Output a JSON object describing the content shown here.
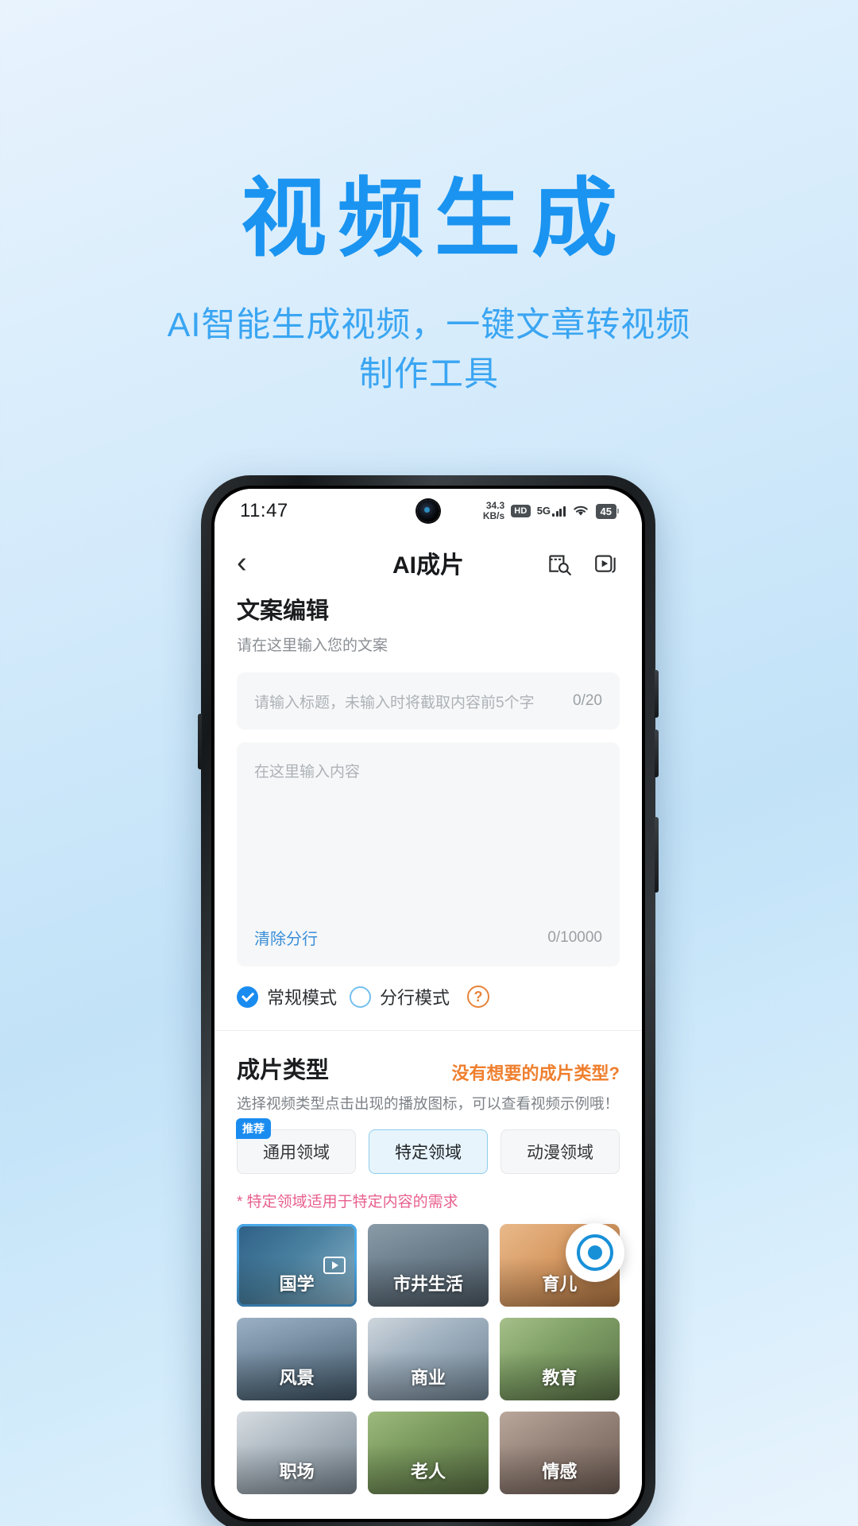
{
  "promo": {
    "title": "视频生成",
    "subtitle_line1": "AI智能生成视频，一键文章转视频",
    "subtitle_line2": "制作工具",
    "title_color": "#1a94f0",
    "subtitle_color": "#3aa5f2"
  },
  "statusbar": {
    "time": "11:47",
    "net_speed": "34.3",
    "net_speed_unit": "KB/s",
    "hd": "HD",
    "network": "5G",
    "battery": "45"
  },
  "navbar": {
    "back_icon": "chevron-left-icon",
    "title": "AI成片",
    "action_1_icon": "document-search-icon",
    "action_2_icon": "video-stack-icon"
  },
  "editor": {
    "section_title": "文案编辑",
    "section_desc": "请在这里输入您的文案",
    "title_placeholder": "请输入标题，未输入时将截取内容前5个字",
    "title_counter": "0/20",
    "body_placeholder": "在这里输入内容",
    "clear_breaks_label": "清除分行",
    "body_counter": "0/10000"
  },
  "modes": {
    "option_1": "常规模式",
    "option_1_selected": true,
    "option_2": "分行模式",
    "option_2_selected": false,
    "help_icon": "question-mark-icon",
    "help_glyph": "?",
    "selected_color": "#1a8cf0",
    "help_color": "#e8833a"
  },
  "film_type": {
    "section_title": "成片类型",
    "link": "没有想要的成片类型?",
    "link_color": "#ef7f2e",
    "desc": "选择视频类型点击出现的播放图标，可以查看视频示例哦！",
    "hint": "* 特定领域适用于特定内容的需求",
    "hint_color": "#e8608e",
    "recommend_badge": "推荐",
    "tabs": [
      {
        "label": "通用领域",
        "active": false,
        "badge": "推荐"
      },
      {
        "label": "特定领域",
        "active": true,
        "badge": ""
      },
      {
        "label": "动漫领域",
        "active": false,
        "badge": ""
      }
    ],
    "tiles": [
      {
        "label": "国学",
        "art": "t-guoxue",
        "selected": true,
        "play": true
      },
      {
        "label": "市井生活",
        "art": "t-shijing",
        "selected": false,
        "play": false
      },
      {
        "label": "育儿",
        "art": "t-yuer",
        "selected": false,
        "play": false
      },
      {
        "label": "风景",
        "art": "t-fengjing",
        "selected": false,
        "play": false
      },
      {
        "label": "商业",
        "art": "t-shangye",
        "selected": false,
        "play": false
      },
      {
        "label": "教育",
        "art": "t-jiaoyu",
        "selected": false,
        "play": false
      },
      {
        "label": "职场",
        "art": "t-zhichang",
        "selected": false,
        "play": false
      },
      {
        "label": "老人",
        "art": "t-laoren",
        "selected": false,
        "play": false
      },
      {
        "label": "情感",
        "art": "t-qinggan",
        "selected": false,
        "play": false
      }
    ]
  },
  "fab": {
    "icon": "assistant-ball-icon"
  }
}
